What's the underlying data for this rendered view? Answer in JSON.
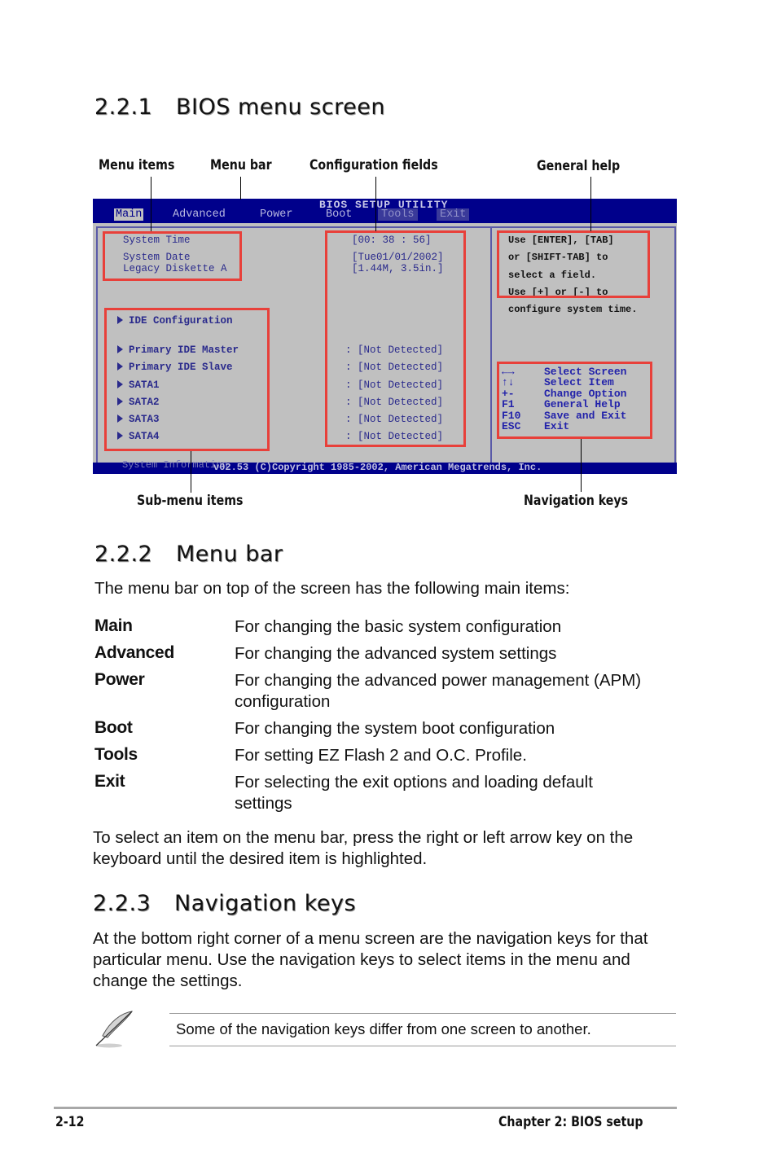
{
  "section_221": {
    "number": "2.2.1",
    "title": "BIOS menu screen"
  },
  "callouts": {
    "menu_items": "Menu items",
    "menu_bar": "Menu bar",
    "configuration_fields": "Configuration fields",
    "general_help": "General help",
    "sub_menu_items": "Sub-menu items",
    "navigation_keys": "Navigation keys"
  },
  "bios": {
    "title": "BIOS SETUP UTILITY",
    "menu": [
      "Main",
      "Advanced",
      "Power",
      "Boot",
      "Tools",
      "Exit"
    ],
    "active_menu": "Main",
    "items": [
      {
        "label": "System Time",
        "value": "[00: 38 : 56]"
      },
      {
        "label": "System Date",
        "value": "[Tue01/01/2002]"
      },
      {
        "label": "Legacy Diskette A",
        "value": "[1.44M, 3.5in.]"
      }
    ],
    "submenus": [
      {
        "label": "IDE Configuration",
        "value": ""
      },
      {
        "label": "Primary IDE Master",
        "value": ": [Not Detected]"
      },
      {
        "label": "Primary IDE Slave",
        "value": ": [Not Detected]"
      },
      {
        "label": "SATA1",
        "value": ": [Not Detected]"
      },
      {
        "label": "SATA2",
        "value": ": [Not Detected]"
      },
      {
        "label": "SATA3",
        "value": ": [Not Detected]"
      },
      {
        "label": "SATA4",
        "value": ": [Not Detected]"
      }
    ],
    "hidden_submenu": "System Information",
    "help_lines": [
      "Use [ENTER], [TAB]",
      "or [SHIFT-TAB] to",
      "select a field.",
      "Use [+] or [-] to",
      "configure system time."
    ],
    "nav_keys": [
      {
        "key": "←→",
        "action": "Select Screen"
      },
      {
        "key": "↑↓",
        "action": "Select Item"
      },
      {
        "key": "+-",
        "action": "Change Option"
      },
      {
        "key": "F1",
        "action": "General Help"
      },
      {
        "key": "F10",
        "action": "Save and Exit"
      },
      {
        "key": "ESC",
        "action": "Exit"
      }
    ],
    "footer": "v02.53 (C)Copyright 1985-2002, American Megatrends, Inc."
  },
  "section_222": {
    "number": "2.2.2",
    "title": "Menu bar",
    "intro": "The menu bar on top of the screen has the following main items:",
    "items": [
      {
        "term": "Main",
        "desc": "For changing the basic system configuration"
      },
      {
        "term": "Advanced",
        "desc": "For changing the advanced system settings"
      },
      {
        "term": "Power",
        "desc": "For changing the advanced power management (APM) configuration"
      },
      {
        "term": "Boot",
        "desc": "For changing the system boot configuration"
      },
      {
        "term": "Tools",
        "desc": "For setting EZ Flash 2 and O.C. Profile."
      },
      {
        "term": "Exit",
        "desc": "For selecting the exit options and loading default settings"
      }
    ],
    "outro": "To select an item on the menu bar, press the right or left arrow key on the keyboard until the desired item is highlighted."
  },
  "section_223": {
    "number": "2.2.3",
    "title": "Navigation keys",
    "body": "At the bottom right corner of a menu screen are the navigation keys for that particular menu. Use the navigation keys to select items in the menu and change the settings.",
    "note": "Some of the navigation keys differ from one screen to another.",
    "note_icon": "quill-pen-icon"
  },
  "footer": {
    "page": "2-12",
    "chapter": "Chapter 2: BIOS setup"
  },
  "colors": {
    "bios_blue": "#00008b",
    "bios_gray": "#c0c0c0",
    "highlight_red": "#e8403a"
  }
}
